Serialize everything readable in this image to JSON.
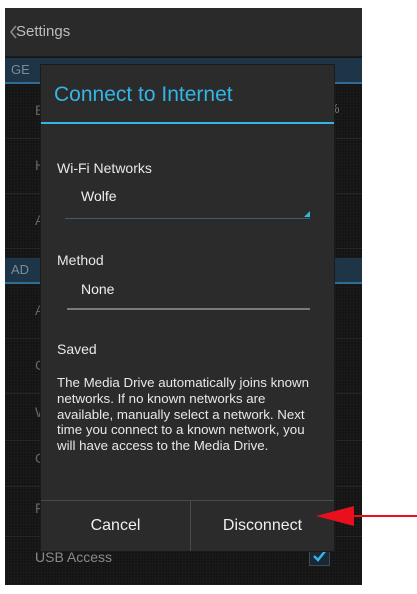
{
  "actionbar": {
    "title": "Settings",
    "back_icon": "chevron-left-icon"
  },
  "background": {
    "section_1_label": "GE",
    "section_2_label": "AD",
    "rows_group_1": [
      "B",
      "H",
      "A"
    ],
    "rows_group_2": [
      "A",
      "C",
      "W",
      "C",
      "F"
    ],
    "percent_suffix": "%",
    "usb_access_label": "USB Access",
    "usb_access_checked": true
  },
  "dialog": {
    "title": "Connect to Internet",
    "wifi_label": "Wi-Fi Networks",
    "wifi_value": "Wolfe",
    "method_label": "Method",
    "method_value": "None",
    "status_text": "Saved",
    "description": "The Media Drive automatically joins known networks. If no known networks are available, manually select a network. Next time you connect to a known network, you will have access to the Media Drive.",
    "cancel_label": "Cancel",
    "disconnect_label": "Disconnect"
  },
  "colors": {
    "accent": "#33b5e5",
    "callout_arrow": "#e8101d",
    "dialog_bg": "#2b2b2b",
    "screen_bg": "#141414"
  }
}
